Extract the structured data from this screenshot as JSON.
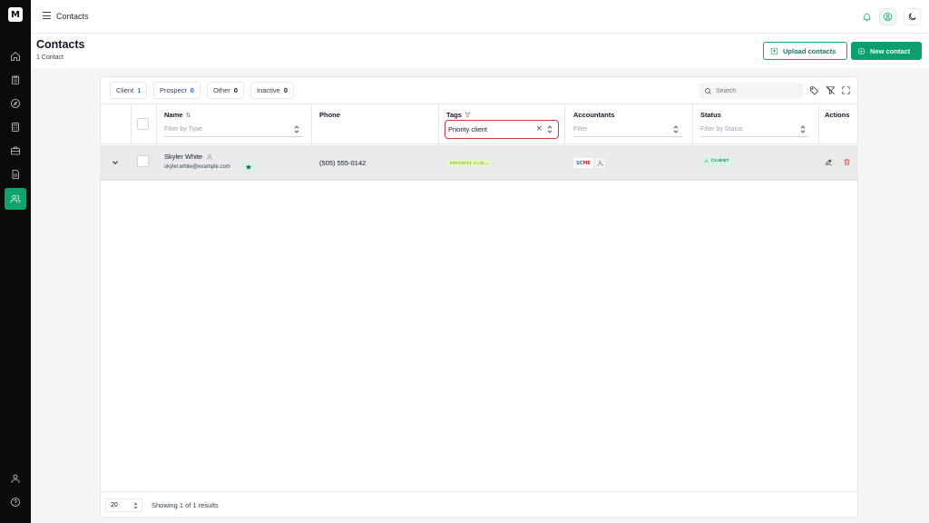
{
  "app": {
    "logo_text": "M"
  },
  "topbar": {
    "title": "Contacts"
  },
  "page": {
    "title": "Contacts",
    "subtitle": "1 Contact",
    "upload_label": "Upload contacts",
    "new_label": "New contact"
  },
  "segments": [
    {
      "label": "Client",
      "count": "1"
    },
    {
      "label": "Prospect",
      "count": "0"
    },
    {
      "label": "Other",
      "count": "0"
    },
    {
      "label": "Inactive",
      "count": "0"
    }
  ],
  "search": {
    "placeholder": "Search"
  },
  "table": {
    "columns": {
      "name": "Name",
      "phone": "Phone",
      "tags": "Tags",
      "accountants": "Accountants",
      "status": "Status",
      "actions": "Actions"
    },
    "filters": {
      "name_placeholder": "Filter by Type",
      "tags_value": "Priority client",
      "accountants_placeholder": "Filter",
      "status_placeholder": "Filter by Status"
    },
    "rows": [
      {
        "name": "Skyler White",
        "email": "skyler.white@example.com",
        "phone": "(505) 555-0142",
        "tag": "PRIORITY CLIE...",
        "accountant_logo_a": "SC",
        "accountant_logo_b": "ME",
        "status": "CLIENT"
      }
    ]
  },
  "footer": {
    "page_size": "20",
    "showing": "Showing 1 of 1 results"
  },
  "colors": {
    "accent": "#10a36b",
    "highlight_border": "#d03b3b",
    "delete": "#dc2626"
  }
}
